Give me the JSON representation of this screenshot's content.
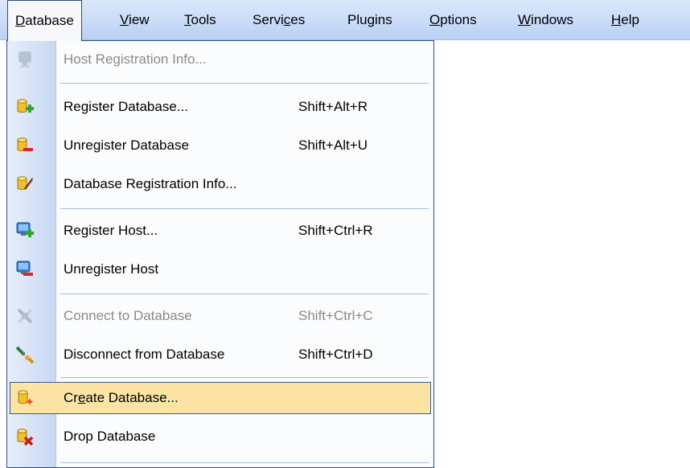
{
  "menubar": {
    "items": [
      {
        "pre": "",
        "u": "D",
        "post": "atabase"
      },
      {
        "pre": "",
        "u": "V",
        "post": "iew"
      },
      {
        "pre": "",
        "u": "T",
        "post": "ools"
      },
      {
        "pre": "Servi",
        "u": "c",
        "post": "es"
      },
      {
        "pre": "Plugins",
        "u": "",
        "post": ""
      },
      {
        "pre": "",
        "u": "O",
        "post": "ptions"
      },
      {
        "pre": "",
        "u": "W",
        "post": "indows"
      },
      {
        "pre": "",
        "u": "H",
        "post": "elp"
      }
    ]
  },
  "menu": {
    "items": [
      {
        "label": "Host Registration Info...",
        "shortcut": "",
        "icon": "host-info-icon"
      },
      {
        "label": "Register Database...",
        "shortcut": "Shift+Alt+R",
        "icon": "register-database-icon"
      },
      {
        "label": "Unregister Database",
        "shortcut": "Shift+Alt+U",
        "icon": "unregister-database-icon"
      },
      {
        "label": "Database Registration Info...",
        "shortcut": "",
        "icon": "database-info-icon"
      },
      {
        "label": "Register Host...",
        "shortcut": "Shift+Ctrl+R",
        "icon": "register-host-icon"
      },
      {
        "label": "Unregister Host",
        "shortcut": "",
        "icon": "unregister-host-icon"
      },
      {
        "label": "Connect to Database",
        "shortcut": "Shift+Ctrl+C",
        "icon": "connect-icon"
      },
      {
        "label": "Disconnect from Database",
        "shortcut": "Shift+Ctrl+D",
        "icon": "disconnect-icon"
      },
      {
        "label_pre": "Cr",
        "label_u": "e",
        "label_post": "ate Database...",
        "shortcut": "",
        "icon": "create-database-icon"
      },
      {
        "label": "Drop Database",
        "shortcut": "",
        "icon": "drop-database-icon"
      }
    ]
  },
  "colors": {
    "menubar": "#c9dcf8",
    "highlight": "#fde4a4",
    "menu_border": "#2e4b80",
    "disabled_text": "#8a8a8a"
  }
}
